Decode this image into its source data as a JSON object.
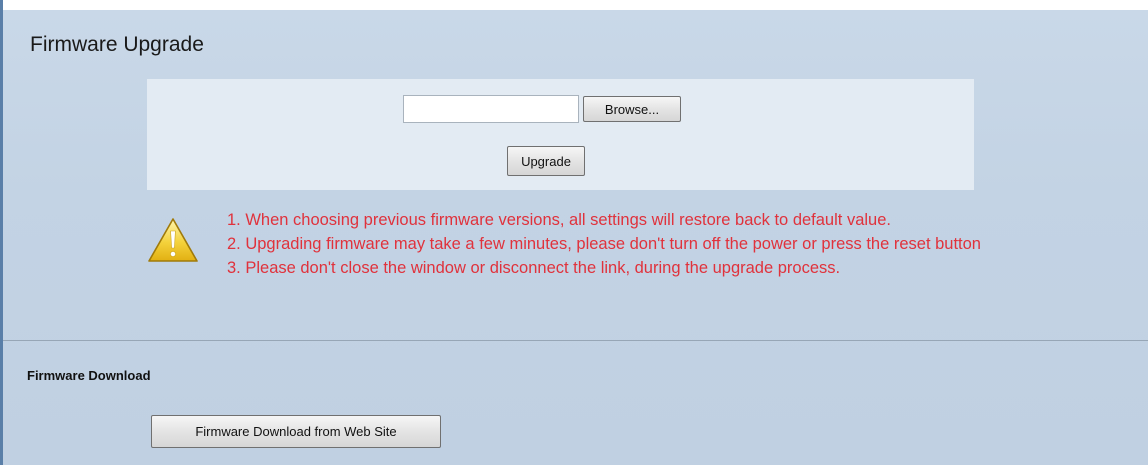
{
  "page": {
    "title": "Firmware Upgrade"
  },
  "upgrade_panel": {
    "file_input": {
      "value": "",
      "placeholder": ""
    },
    "browse_label": "Browse...",
    "upgrade_label": "Upgrade"
  },
  "warnings": {
    "icon": "warning-triangle-icon",
    "lines": [
      "1. When choosing previous firmware versions, all settings will restore back to default value.",
      "2. Upgrading firmware may take a few minutes, please don't turn off the power or press the reset button",
      "3. Please don't close the window or disconnect the link, during the upgrade process."
    ]
  },
  "download_section": {
    "heading": "Firmware Download",
    "button_label": "Firmware Download from Web Site"
  },
  "colors": {
    "warning_text": "#e0323c",
    "background": "#c3d3e4",
    "panel": "#e3ebf3"
  }
}
